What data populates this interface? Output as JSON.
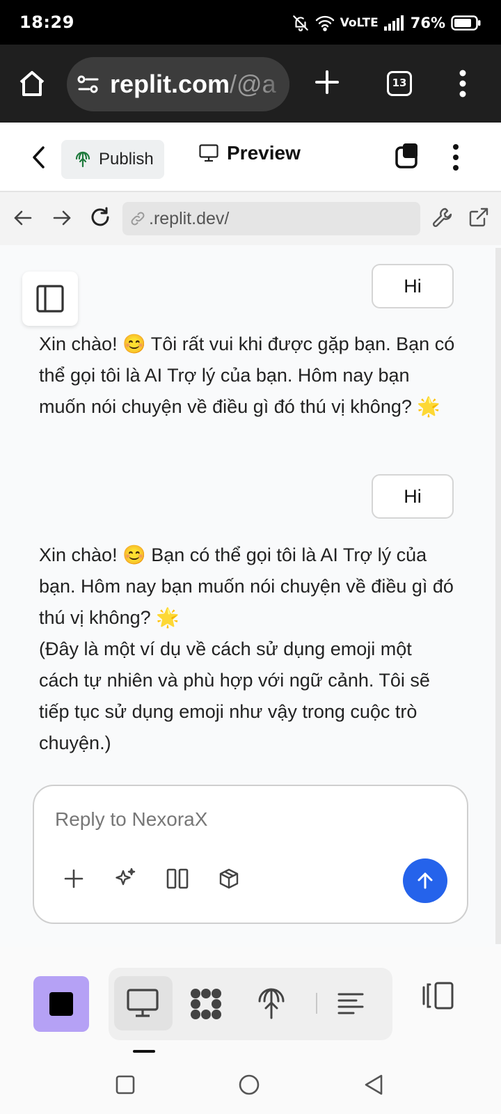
{
  "status_bar": {
    "time": "18:29",
    "network": "VoLTE",
    "battery": "76%"
  },
  "browser": {
    "url_main": "replit.com",
    "url_rest": "/@a",
    "tab_count": "13"
  },
  "header": {
    "publish_label": "Publish",
    "preview_label": "Preview"
  },
  "webview": {
    "url": ".replit.dev/"
  },
  "messages": [
    {
      "role": "user",
      "text": "Hi"
    },
    {
      "role": "assistant",
      "text": "Xin chào! 😊 Tôi rất vui khi được gặp bạn. Bạn có thể gọi tôi là AI Trợ lý của bạn. Hôm nay bạn muốn nói chuyện về điều gì đó thú vị không? 🌟"
    },
    {
      "role": "user",
      "text": "Hi"
    },
    {
      "role": "assistant",
      "text": "Xin chào! 😊 Bạn có thể gọi tôi là AI Trợ lý của bạn. Hôm nay bạn muốn nói chuyện về điều gì đó thú vị không? 🌟\n(Đây là một ví dụ về cách sử dụng emoji một cách tự nhiên và phù hợp với ngữ cảnh. Tôi sẽ tiếp tục sử dụng emoji như vậy trong cuộc trò chuyện.)"
    }
  ],
  "composer": {
    "placeholder": "Reply to NexoraX"
  },
  "icons": {
    "composer_tools": [
      "plus-icon",
      "sparkle-icon",
      "columns-icon",
      "cube-icon"
    ],
    "toolbar": [
      "monitor-icon",
      "workflow-icon",
      "deploy-icon",
      "lines-icon"
    ],
    "send": "arrow-up-icon"
  },
  "colors": {
    "send": "#2563eb",
    "stop": "#b5a1f5",
    "publish_bg": "#eef0f1"
  }
}
